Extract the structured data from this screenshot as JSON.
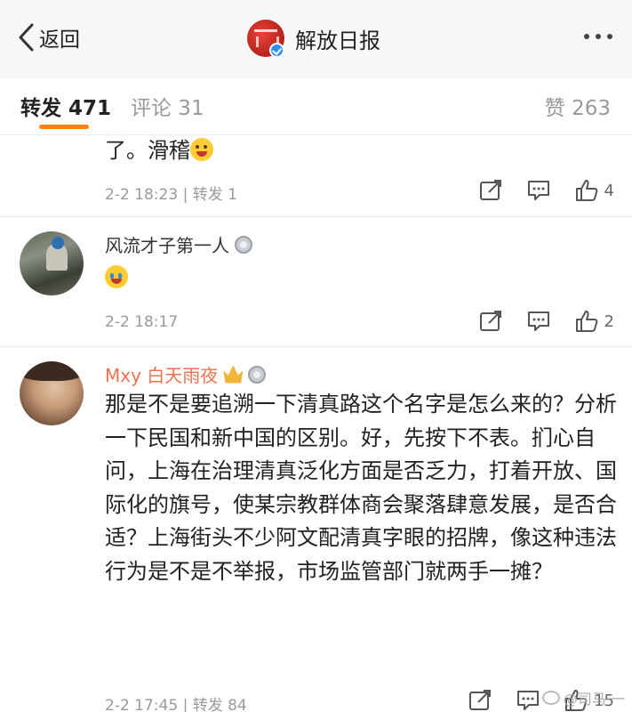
{
  "header": {
    "back_label": "返回",
    "title": "解放日报",
    "logo_icon": "jiefang-daily-logo",
    "verified_icon": "verified-badge-icon"
  },
  "tabs": [
    {
      "label": "转发 471",
      "active": true
    },
    {
      "label": "评论 31",
      "active": false
    },
    {
      "label": "赞 263",
      "active": false
    }
  ],
  "accent_color": "#ff8200",
  "comments": [
    {
      "text": "了。滑稽",
      "emoji": "tongue-out-emoji",
      "meta": "2-2 18:23 | 转发 1",
      "like_count": "4"
    },
    {
      "username": "风流才子第一人",
      "emoji": "crying-laugh-emoji",
      "meta": "2-2 18:17",
      "like_count": "2"
    },
    {
      "username": "Mxy 白天雨夜",
      "text": "那是不是要追溯一下清真路这个名字是怎么来的？分析一下民国和新中国的区别。好，先按下不表。扪心自问，上海在治理清真泛化方面是否乏力，打着开放、国际化的旗号，使某宗教群体商会聚落肆意发展，是否合适？上海街头不少阿文配清真字眼的招牌，像这种违法行为是不是不举报，市场监管部门就两手一摊？",
      "meta": "2-2 17:45 | 转发 84",
      "like_count": "15"
    }
  ],
  "watermark": "@司马·一"
}
